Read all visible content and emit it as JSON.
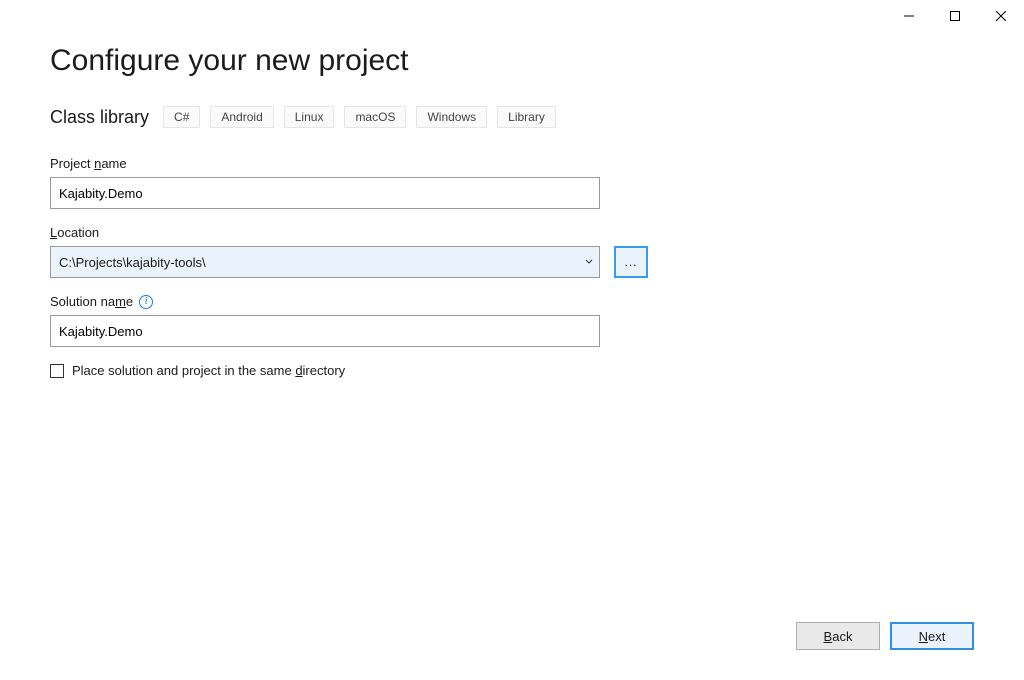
{
  "window": {
    "minimize_label": "Minimize",
    "maximize_label": "Maximize",
    "close_label": "Close"
  },
  "page": {
    "title": "Configure your new project",
    "template_name": "Class library",
    "tags": [
      "C#",
      "Android",
      "Linux",
      "macOS",
      "Windows",
      "Library"
    ]
  },
  "fields": {
    "project_name": {
      "label_pre": "Project ",
      "label_ul": "n",
      "label_post": "ame",
      "value": "Kajabity.Demo"
    },
    "location": {
      "label_ul": "L",
      "label_post": "ocation",
      "value": "C:\\Projects\\kajabity-tools\\",
      "browse_label": "..."
    },
    "solution_name": {
      "label_pre": "Solution na",
      "label_ul": "m",
      "label_post": "e",
      "value": "Kajabity.Demo"
    },
    "same_dir": {
      "label_pre": "Place solution and project in the same ",
      "label_ul": "d",
      "label_post": "irectory",
      "checked": false
    }
  },
  "footer": {
    "back_ul": "B",
    "back_post": "ack",
    "next_ul": "N",
    "next_post": "ext"
  }
}
